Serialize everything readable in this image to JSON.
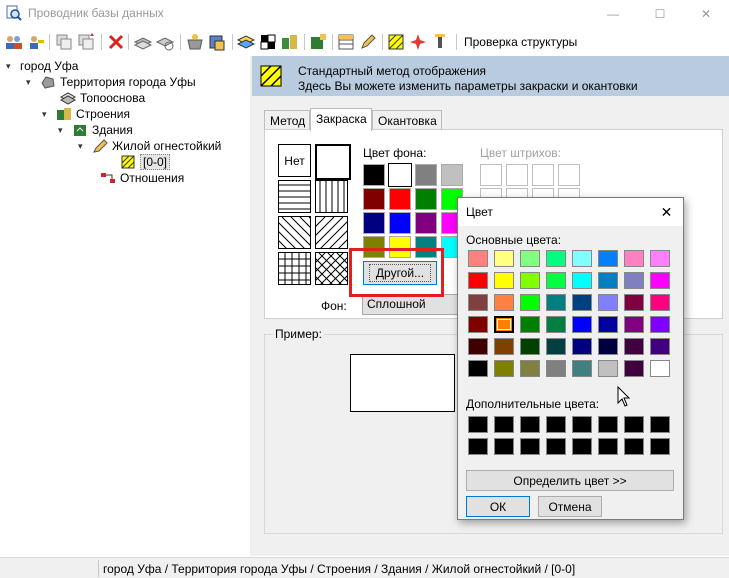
{
  "window": {
    "title": "Проводник базы данных",
    "minimize_glyph": "—",
    "maximize_glyph": "☐",
    "close_glyph": "✕"
  },
  "toolbar": {
    "structure_check_label": "Проверка структуры"
  },
  "tree": {
    "items": [
      {
        "label": "город Уфа",
        "toggle": "▾"
      },
      {
        "label": "Территория города Уфы",
        "toggle": "▾"
      },
      {
        "label": "Топооснова",
        "toggle": ""
      },
      {
        "label": "Строения",
        "toggle": "▾"
      },
      {
        "label": "Здания",
        "toggle": "▾"
      },
      {
        "label": "Жилой огнестойкий",
        "toggle": "▾"
      },
      {
        "label": "[0-0]",
        "toggle": ""
      },
      {
        "label": "Отношения",
        "toggle": ""
      }
    ]
  },
  "header": {
    "line1": "Стандартный метод отображения",
    "line2": "Здесь Вы можете изменить параметры закраски и окантовки"
  },
  "tabs": [
    {
      "label": "Метод"
    },
    {
      "label": "Закраска"
    },
    {
      "label": "Окантовка"
    }
  ],
  "fill": {
    "no_fill_label": "Нет",
    "bg_color_label": "Цвет фона:",
    "hatch_color_label": "Цвет штрихов:",
    "other_button_label": "Другой...",
    "background_label": "Фон:",
    "background_value": "Сплошной",
    "palette": [
      "#000000",
      "#ffffff",
      "#808080",
      "#c0c0c0",
      "#800000",
      "#ff0000",
      "#008000",
      "#00ff00",
      "#000080",
      "#0000ff",
      "#800080",
      "#ff00ff",
      "#808000",
      "#ffff00",
      "#008080",
      "#00ffff"
    ],
    "selected_index": 1
  },
  "example": {
    "label": "Пример:"
  },
  "status": {
    "path": "город Уфа / Территория города Уфы / Строения / Здания / Жилой огнестойкий / [0-0]"
  },
  "color_dialog": {
    "title": "Цвет",
    "close_glyph": "✕",
    "basic_colors_label": "Основные цвета:",
    "custom_colors_label": "Дополнительные цвета:",
    "define_button_label": "Определить цвет >>",
    "ok_label": "ОК",
    "cancel_label": "Отмена",
    "basic_colors": [
      "#ff8080",
      "#ffff80",
      "#80ff80",
      "#00ff80",
      "#80ffff",
      "#0080ff",
      "#ff80c0",
      "#ff80ff",
      "#ff0000",
      "#ffff00",
      "#80ff00",
      "#00ff40",
      "#00ffff",
      "#0080c0",
      "#8080c0",
      "#ff00ff",
      "#804040",
      "#ff8040",
      "#00ff00",
      "#008080",
      "#004080",
      "#8080ff",
      "#800040",
      "#ff0080",
      "#800000",
      "#ff8000",
      "#008000",
      "#008040",
      "#0000ff",
      "#0000a0",
      "#800080",
      "#8000ff",
      "#400000",
      "#804000",
      "#004000",
      "#004040",
      "#000080",
      "#000040",
      "#400040",
      "#400080",
      "#000000",
      "#808000",
      "#808040",
      "#808080",
      "#408080",
      "#c0c0c0",
      "#400040",
      "#ffffff"
    ],
    "selected_basic_index": 25,
    "custom_colors": [
      "#000000",
      "#000000",
      "#000000",
      "#000000",
      "#000000",
      "#000000",
      "#000000",
      "#000000",
      "#000000",
      "#000000",
      "#000000",
      "#000000",
      "#000000",
      "#000000",
      "#000000",
      "#000000"
    ]
  }
}
